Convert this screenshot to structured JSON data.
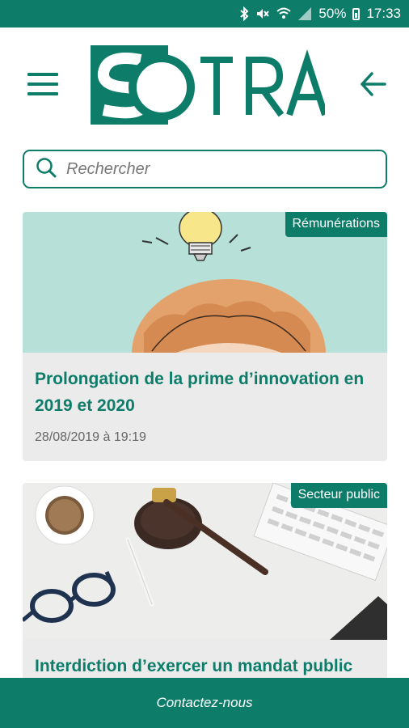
{
  "status_bar": {
    "battery": "50%",
    "time": "17:33"
  },
  "header": {
    "logo_text": "SOTRA",
    "menu_icon": "hamburger-menu-icon",
    "back_icon": "arrow-left-icon"
  },
  "search": {
    "placeholder": "Rechercher",
    "icon": "search-icon"
  },
  "articles": [
    {
      "category": "Rémunérations",
      "title": "Prolongation de la prime d’innovation en 2019 et 2020",
      "date": "28/08/2019 à 19:19",
      "image": "illustration-lightbulb-head"
    },
    {
      "category": "Secteur public",
      "title": "Interdiction d’exercer un mandat public",
      "image": "desk-gavel-coffee-glasses"
    }
  ],
  "footer": {
    "contact_label": "Contactez-nous"
  },
  "colors": {
    "brand": "#0d7d6a",
    "card_bg": "#ebebeb",
    "illustration_bg": "#b7e0d9"
  }
}
